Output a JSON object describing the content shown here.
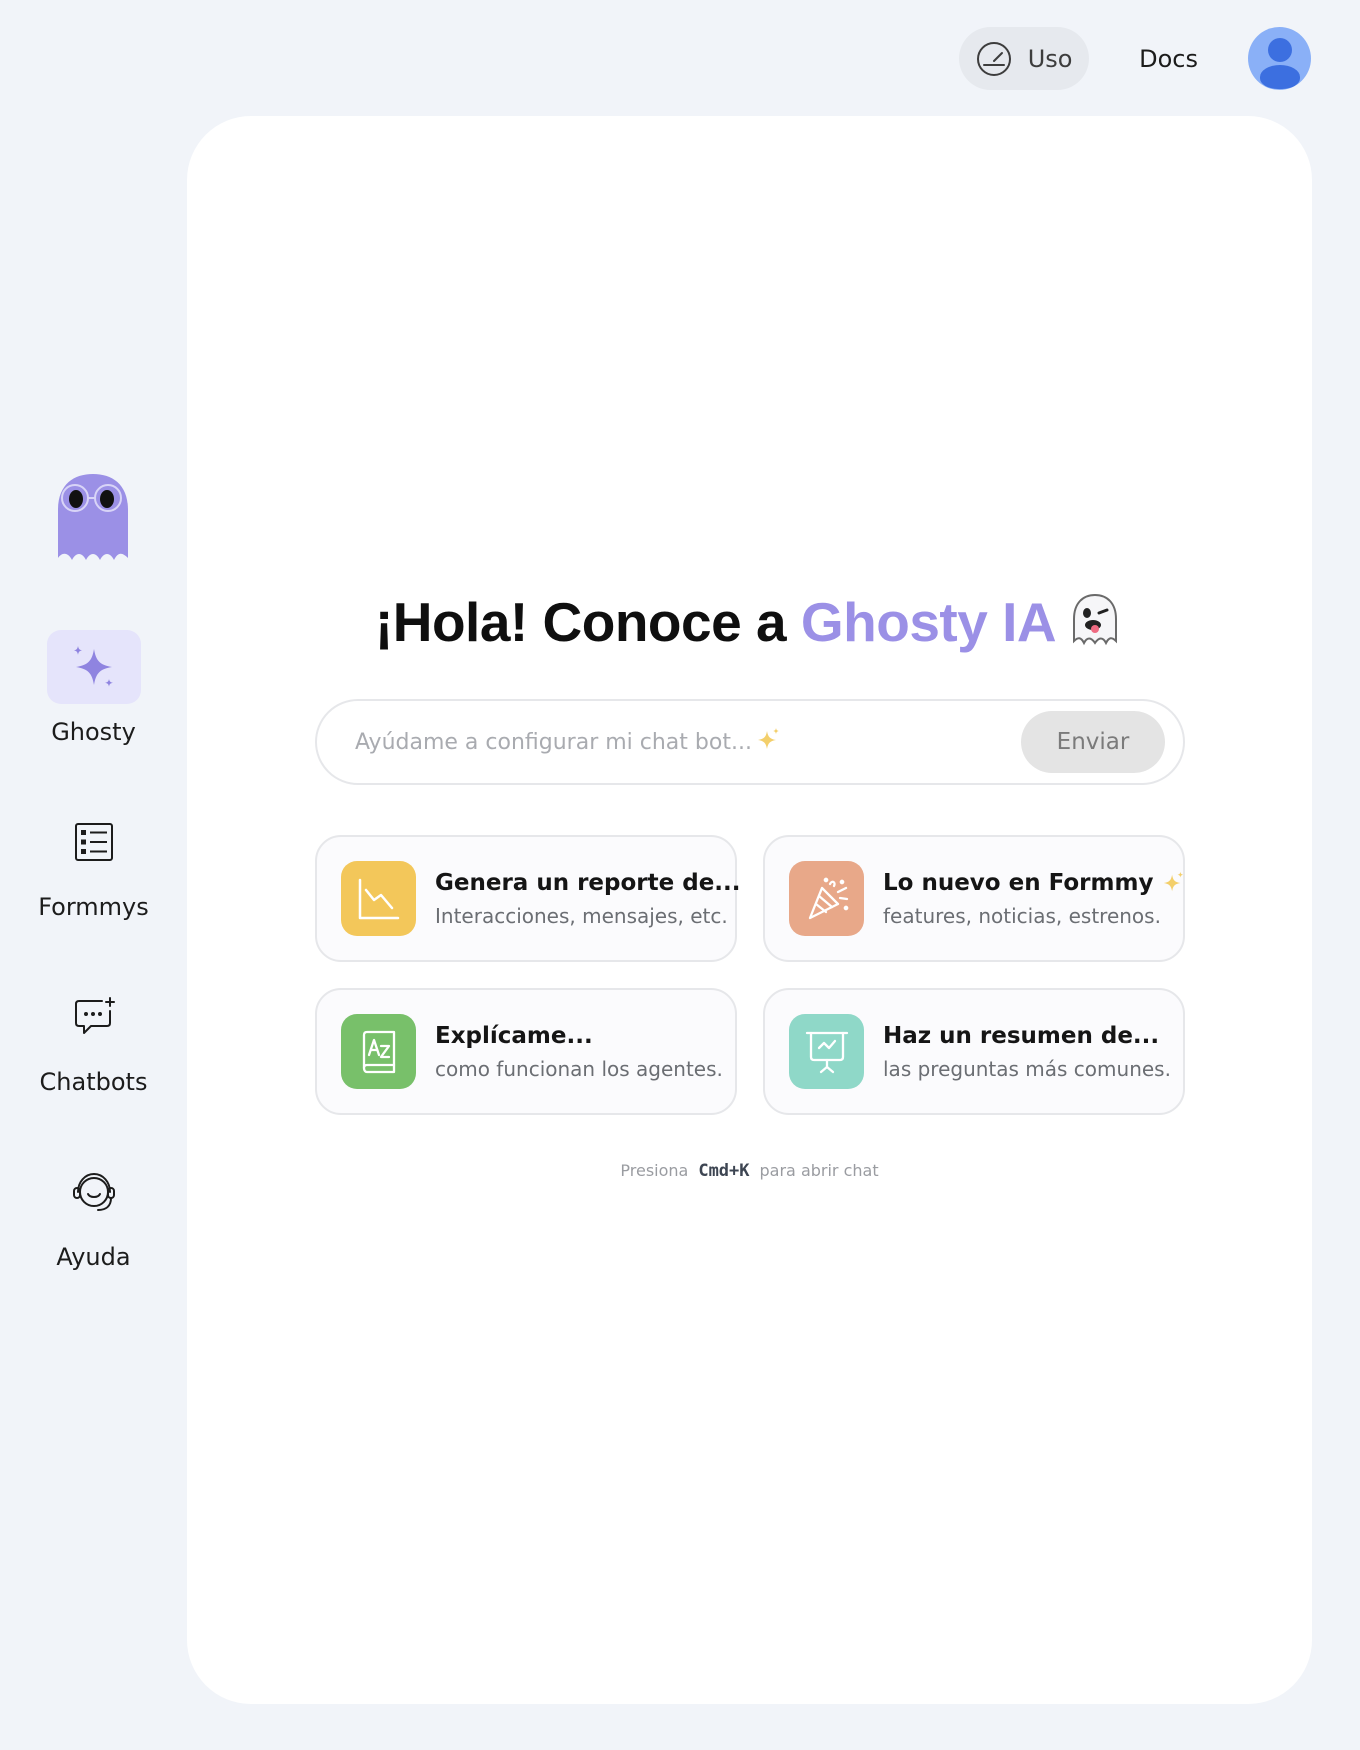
{
  "topbar": {
    "usage_label": "Uso",
    "docs_label": "Docs",
    "usage_icon": "gauge-icon",
    "avatar_icon": "user-avatar"
  },
  "sidebar": {
    "logo_icon": "ghost-mascot-icon",
    "items": [
      {
        "label": "Ghosty",
        "icon": "sparkle-icon",
        "active": true
      },
      {
        "label": "Formmys",
        "icon": "list-form-icon",
        "active": false
      },
      {
        "label": "Chatbots",
        "icon": "chat-bubble-icon",
        "active": false
      },
      {
        "label": "Ayuda",
        "icon": "headset-icon",
        "active": false
      }
    ]
  },
  "main": {
    "headline_prefix": "¡Hola! Conoce a ",
    "headline_accent": "Ghosty IA",
    "headline_emoji": "ghost-emoji",
    "prompt_placeholder": "Ayúdame a configurar mi chat bot...",
    "send_label": "Enviar",
    "cards": [
      {
        "title": "Genera un reporte de...",
        "subtitle": "Interacciones, mensajes, etc.",
        "icon": "chart-icon",
        "color": "#f3c75a"
      },
      {
        "title": "Lo nuevo en Formmy",
        "subtitle": "features, noticias, estrenos.",
        "icon": "party-popper-icon",
        "color": "#e8a889"
      },
      {
        "title": "Explícame...",
        "subtitle": "como funcionan los agentes.",
        "icon": "dictionary-icon",
        "color": "#78c06a"
      },
      {
        "title": "Haz un resumen de...",
        "subtitle": "las preguntas más comunes.",
        "icon": "presentation-icon",
        "color": "#8fd8c8"
      }
    ],
    "hint_before": "Presiona",
    "hint_key": "Cmd+K",
    "hint_after": "para abrir chat"
  },
  "colors": {
    "accent": "#9b90e6",
    "background": "#f1f4f9",
    "active_nav": "#e5e4fb"
  }
}
